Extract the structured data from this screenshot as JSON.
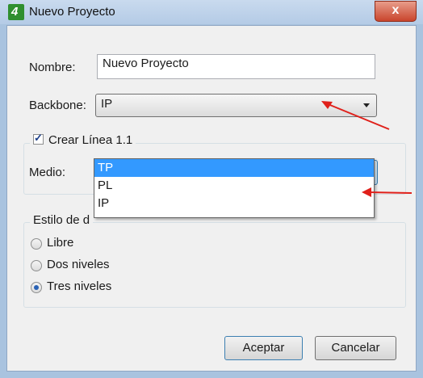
{
  "window": {
    "title": "Nuevo Proyecto",
    "app_icon": "4",
    "close_label": "x"
  },
  "form": {
    "nombre_label": "Nombre:",
    "nombre_value": "Nuevo Proyecto",
    "backbone_label": "Backbone:",
    "backbone_value": "IP",
    "crear_linea_label": "Crear Línea 1.1",
    "crear_linea_checked": true,
    "medio_label": "Medio:",
    "medio_value": "TP",
    "medio_options": [
      "TP",
      "PL",
      "IP"
    ],
    "medio_selected_index": 0,
    "estilo_label": "Estilo de d",
    "estilo_options": [
      "Libre",
      "Dos niveles",
      "Tres niveles"
    ],
    "estilo_selected_index": 2
  },
  "buttons": {
    "accept": "Aceptar",
    "cancel": "Cancelar"
  },
  "colors": {
    "selection": "#3399ff",
    "annotation_arrow": "#e0201a",
    "close_button": "#c9452d"
  }
}
